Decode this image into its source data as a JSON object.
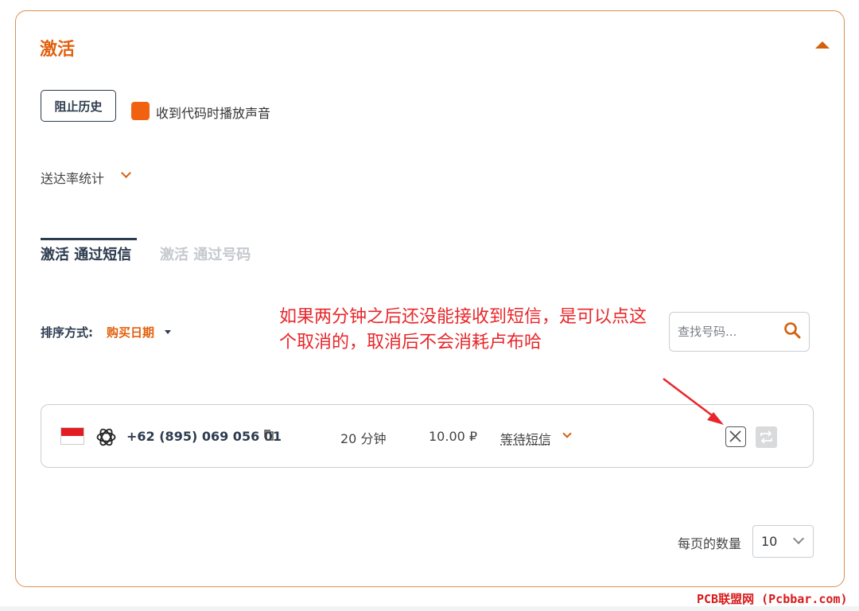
{
  "panel": {
    "title": "激活"
  },
  "controls": {
    "history_button": "阻止历史",
    "sound_label": "收到代码时播放声音",
    "stats_label": "送达率统计"
  },
  "tabs": [
    {
      "label": "激活 通过短信",
      "active": true
    },
    {
      "label": "激活 通过号码",
      "active": false
    }
  ],
  "sort": {
    "label": "排序方式:",
    "value": "购买日期"
  },
  "annotation": {
    "text": "如果两分钟之后还没能接收到短信，是可以点这个取消的，取消后不会消耗卢布哈"
  },
  "search": {
    "placeholder": "查找号码..."
  },
  "activation": {
    "country_flag": "indonesia-flag",
    "service_icon": "openai-icon",
    "phone": "+62 (895) 069 056 01",
    "duration": "20 分钟",
    "price": "10.00 ₽",
    "status": "等待短信"
  },
  "pagination": {
    "per_page_label": "每页的数量",
    "per_page_value": "10"
  },
  "watermark": {
    "text": "PCB联盟网 (Pcbbar.com)"
  },
  "colors": {
    "accent": "#e2600e",
    "navy": "#2d3b4f",
    "annotation": "#e8262a",
    "border": "#d98f55"
  }
}
